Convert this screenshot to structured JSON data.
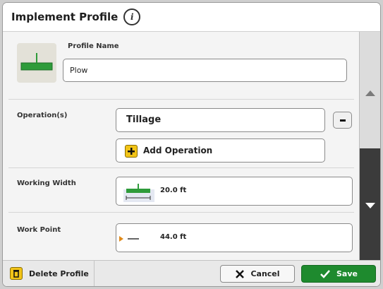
{
  "header": {
    "title": "Implement Profile",
    "info_icon": "i"
  },
  "profile": {
    "name_label": "Profile Name",
    "name_value": "Plow"
  },
  "operations": {
    "label": "Operation(s)",
    "items": [
      "Tillage"
    ],
    "remove_label": "-",
    "add_label": "Add Operation"
  },
  "working_width": {
    "label": "Working Width",
    "value": "20.0 ft"
  },
  "work_point": {
    "label": "Work Point",
    "value": "44.0 ft"
  },
  "footer": {
    "delete_label": "Delete Profile",
    "cancel_label": "Cancel",
    "save_label": "Save"
  },
  "colors": {
    "accent_green": "#1e8a2e",
    "implement_green": "#2e9b3a",
    "plus_yellow": "#f2c418",
    "scroll_thumb": "#3b3b3b"
  }
}
